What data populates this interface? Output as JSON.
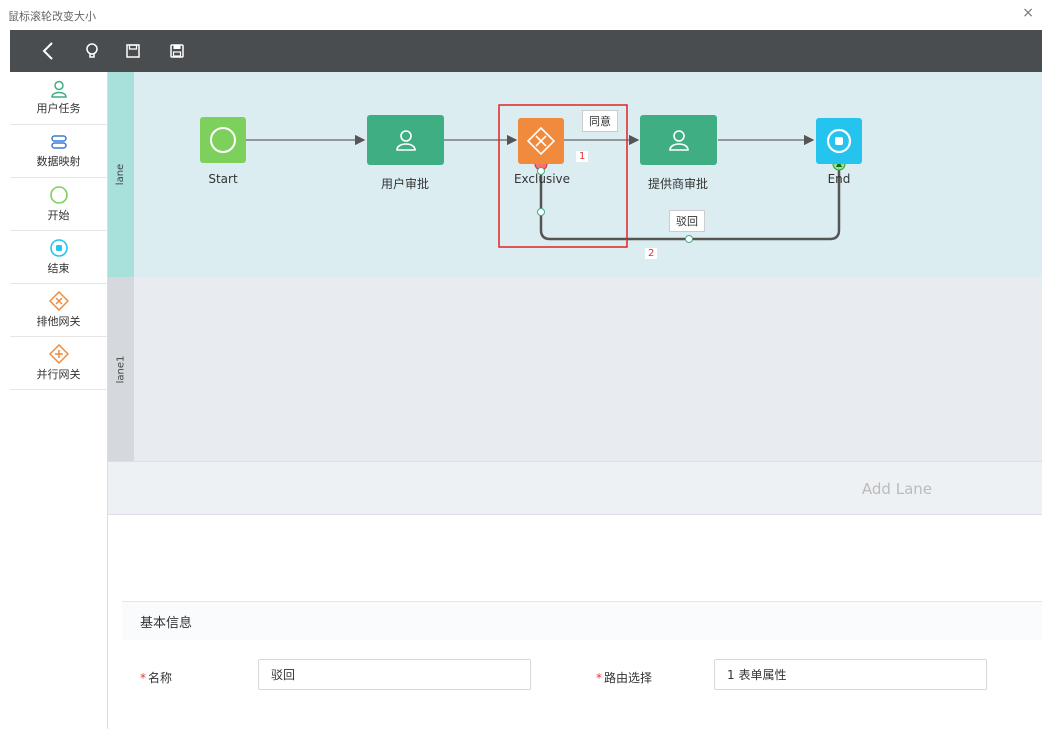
{
  "window": {
    "title": "鼠标滚轮改变大小",
    "close": "×"
  },
  "palette": {
    "items": [
      {
        "label": "用户任务",
        "icon": "user-task-icon"
      },
      {
        "label": "数据映射",
        "icon": "data-mapping-icon"
      },
      {
        "label": "开始",
        "icon": "start-event-icon"
      },
      {
        "label": "结束",
        "icon": "end-event-icon"
      },
      {
        "label": "排他网关",
        "icon": "exclusive-gateway-icon"
      },
      {
        "label": "并行网关",
        "icon": "parallel-gateway-icon"
      }
    ]
  },
  "lanes": [
    {
      "name": "lane"
    },
    {
      "name": "lane1"
    }
  ],
  "add_lane": "Add Lane",
  "nodes": {
    "start": "Start",
    "user_approval": "用户审批",
    "exclusive": "Exclusive",
    "supplier_approval": "提供商审批",
    "end": "End"
  },
  "flows": {
    "agree": "同意",
    "reject": "驳回"
  },
  "markers": {
    "one": "1",
    "two": "2"
  },
  "properties": {
    "title": "基本信息",
    "name_label": "名称",
    "name_value": "驳回",
    "route_label": "路由选择",
    "route_value": "1 表单属性",
    "required_mark": "*"
  },
  "colors": {
    "toolbar": "#4a4d50",
    "start": "#7ed05d",
    "task": "#3fae83",
    "gateway": "#f08a3c",
    "end": "#25c4ef",
    "lane_active": "#dcedf2",
    "lane_header_active": "#a8e0dc",
    "lane_inactive": "#e8ebf0",
    "lane_header_inactive": "#d5d8dd",
    "highlight": "#e02424"
  }
}
